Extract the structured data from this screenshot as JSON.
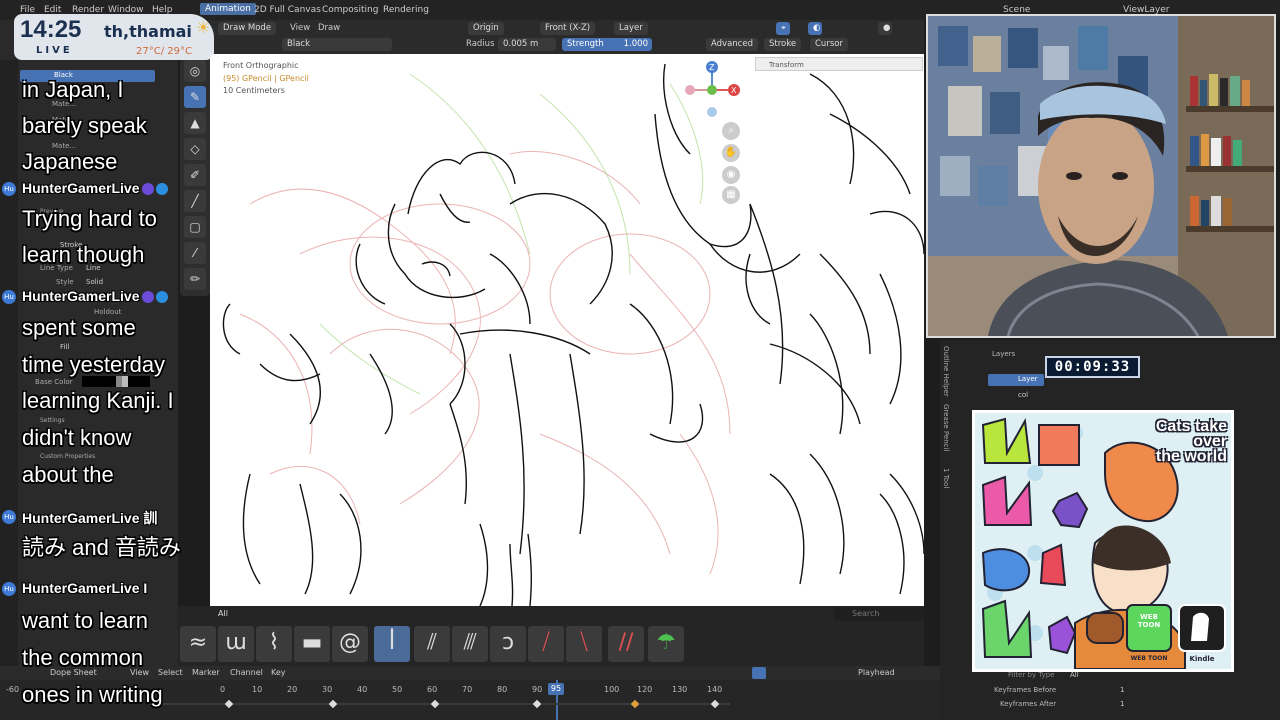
{
  "menu": {
    "items": [
      "File",
      "Edit",
      "Render",
      "Window",
      "Help"
    ],
    "tabs": [
      "Animation",
      "2D Full Canvas",
      "Compositing",
      "Rendering"
    ],
    "active_tab": "Animation",
    "scene": "Scene",
    "view_layer": "ViewLayer"
  },
  "header1": {
    "mode": "Draw Mode",
    "view": "View",
    "draw": "Draw",
    "origin": "Origin",
    "orientation": "Front (X-Z)",
    "layer": "Layer"
  },
  "header2": {
    "material": "Black",
    "radius_label": "Radius",
    "radius_value": "0.005 m",
    "strength_label": "Strength",
    "strength_value": "1.000",
    "advanced": "Advanced",
    "stroke": "Stroke",
    "cursor": "Cursor"
  },
  "viewport": {
    "view_name": "Front Orthographic",
    "object": "(95) GPencil | GPencil",
    "scale": "10 Centimeters",
    "transform": "Transform"
  },
  "left_panel": {
    "material_slot": "Black",
    "mat_items": [
      "Mate...",
      "Mate...",
      "Mate..."
    ],
    "stroke": "Stroke",
    "line_type_label": "Line Type",
    "line_type_value": "Line",
    "style_label": "Style",
    "style_value": "Solid",
    "holdout": "Holdout",
    "fill": "Fill",
    "base_color": "Base Color",
    "settings": "Settings",
    "custom_props": "Custom Properties",
    "preview": "Preview"
  },
  "overlay_clock": {
    "time": "14:25",
    "live": "LIVE",
    "place": "th,thamai",
    "temp": "27°C/ 29°C"
  },
  "chat": {
    "lines": [
      {
        "type": "text",
        "text": "in Japan, I"
      },
      {
        "type": "text",
        "text": "barely speak"
      },
      {
        "type": "text",
        "text": "Japanese"
      },
      {
        "type": "user",
        "text": "HunterGamerLive"
      },
      {
        "type": "text",
        "text": "Trying hard to"
      },
      {
        "type": "text",
        "text": "learn though"
      },
      {
        "type": "user",
        "text": "HunterGamerLive"
      },
      {
        "type": "text",
        "text": "spent some"
      },
      {
        "type": "text",
        "text": "time yesterday"
      },
      {
        "type": "text",
        "text": "learning Kanji. I"
      },
      {
        "type": "text",
        "text": "didn't know"
      },
      {
        "type": "text",
        "text": "about the"
      },
      {
        "type": "user",
        "text": "HunterGamerLive 訓"
      },
      {
        "type": "text",
        "text": "読み and 音読み"
      },
      {
        "type": "user",
        "text": "HunterGamerLive I"
      },
      {
        "type": "text",
        "text": "want to learn"
      },
      {
        "type": "text",
        "text": "the common"
      },
      {
        "type": "text",
        "text": "ones in writing"
      }
    ]
  },
  "brushes": {
    "filter": "All",
    "search_placeholder": "Search",
    "items": [
      "brush-1",
      "brush-2",
      "brush-3",
      "brush-4",
      "brush-5",
      "brush-6",
      "brush-7",
      "brush-8",
      "brush-9",
      "brush-10",
      "brush-11",
      "brush-12",
      "brush-13"
    ]
  },
  "dope_sheet": {
    "editor": "Dope Sheet",
    "menus": [
      "View",
      "Select",
      "Marker",
      "Channel",
      "Key"
    ],
    "playhead": "Playhead",
    "frames": [
      "0",
      "10",
      "20",
      "30",
      "40",
      "50",
      "60",
      "70",
      "80",
      "90",
      "95",
      "100",
      "120",
      "130",
      "140"
    ],
    "current_frame": "95",
    "left_neg": "-60"
  },
  "right_panel": {
    "header": "Layers",
    "layers": [
      "Layer",
      "col"
    ],
    "filter_by_type": "Filter by Type",
    "filter_value": "All",
    "keyframes_before_label": "Keyframes Before",
    "keyframes_before_value": "1",
    "keyframes_after_label": "Keyframes After",
    "keyframes_after_value": "1",
    "side_tabs": [
      "Outline Helper",
      "Grease Pencil",
      "1 Tool"
    ]
  },
  "timer": "00:09:33",
  "promo": {
    "title_lines": [
      "Cats take",
      "over",
      "the world"
    ],
    "badge1": "WEB TOON",
    "badge1_sub": "WEB TOON",
    "badge2_sub": "Kindle"
  },
  "colors": {
    "accent": "#4772b3",
    "sketch_red": "#e59a9a",
    "sketch_green": "#a9d98a",
    "ink": "#111111"
  }
}
